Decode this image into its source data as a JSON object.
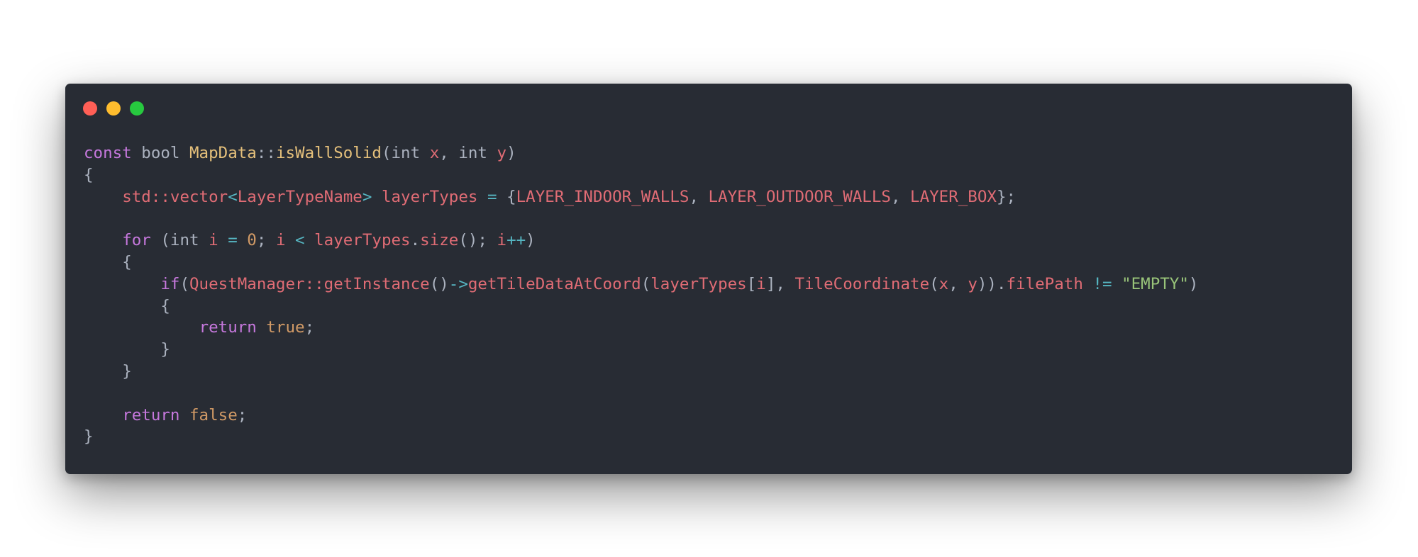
{
  "window": {
    "controls": [
      {
        "name": "close",
        "color": "#ff5f56"
      },
      {
        "name": "minimize",
        "color": "#ffbd2e"
      },
      {
        "name": "maximize",
        "color": "#27c93f"
      }
    ],
    "background": "#282c34"
  },
  "theme": {
    "keyword": "#c678dd",
    "class": "#e5c07b",
    "function": "#e06c75",
    "identifier": "#e06c75",
    "operator": "#56b6c2",
    "number": "#d19a66",
    "string": "#98c379",
    "punctuation": "#abb2bf"
  },
  "code": {
    "lines": [
      [
        {
          "t": "const",
          "c": "keyword"
        },
        {
          "t": " ",
          "c": "plain"
        },
        {
          "t": "bool",
          "c": "type"
        },
        {
          "t": " ",
          "c": "plain"
        },
        {
          "t": "MapData",
          "c": "class"
        },
        {
          "t": "::",
          "c": "punct"
        },
        {
          "t": "isWallSolid",
          "c": "class"
        },
        {
          "t": "(",
          "c": "punct"
        },
        {
          "t": "int",
          "c": "type"
        },
        {
          "t": " ",
          "c": "plain"
        },
        {
          "t": "x",
          "c": "param"
        },
        {
          "t": ", ",
          "c": "punct"
        },
        {
          "t": "int",
          "c": "type"
        },
        {
          "t": " ",
          "c": "plain"
        },
        {
          "t": "y",
          "c": "param"
        },
        {
          "t": ")",
          "c": "punct"
        }
      ],
      [
        {
          "t": "{",
          "c": "punct"
        }
      ],
      [
        {
          "t": "    ",
          "c": "plain"
        },
        {
          "t": "std",
          "c": "ident"
        },
        {
          "t": "::",
          "c": "ident"
        },
        {
          "t": "vector",
          "c": "ident"
        },
        {
          "t": "<",
          "c": "op"
        },
        {
          "t": "LayerTypeName",
          "c": "ident"
        },
        {
          "t": ">",
          "c": "op"
        },
        {
          "t": " ",
          "c": "plain"
        },
        {
          "t": "layerTypes",
          "c": "ident"
        },
        {
          "t": " ",
          "c": "plain"
        },
        {
          "t": "=",
          "c": "op"
        },
        {
          "t": " ",
          "c": "plain"
        },
        {
          "t": "{",
          "c": "punct"
        },
        {
          "t": "LAYER_INDOOR_WALLS",
          "c": "ident"
        },
        {
          "t": ", ",
          "c": "punct"
        },
        {
          "t": "LAYER_OUTDOOR_WALLS",
          "c": "ident"
        },
        {
          "t": ", ",
          "c": "punct"
        },
        {
          "t": "LAYER_BOX",
          "c": "ident"
        },
        {
          "t": "};",
          "c": "punct"
        }
      ],
      [],
      [
        {
          "t": "    ",
          "c": "plain"
        },
        {
          "t": "for",
          "c": "keyword"
        },
        {
          "t": " ",
          "c": "plain"
        },
        {
          "t": "(",
          "c": "punct"
        },
        {
          "t": "int",
          "c": "type"
        },
        {
          "t": " ",
          "c": "plain"
        },
        {
          "t": "i",
          "c": "ident"
        },
        {
          "t": " ",
          "c": "plain"
        },
        {
          "t": "=",
          "c": "op"
        },
        {
          "t": " ",
          "c": "plain"
        },
        {
          "t": "0",
          "c": "number"
        },
        {
          "t": "; ",
          "c": "punct"
        },
        {
          "t": "i",
          "c": "ident"
        },
        {
          "t": " ",
          "c": "plain"
        },
        {
          "t": "<",
          "c": "op"
        },
        {
          "t": " ",
          "c": "plain"
        },
        {
          "t": "layerTypes",
          "c": "ident"
        },
        {
          "t": ".",
          "c": "punct"
        },
        {
          "t": "size",
          "c": "func"
        },
        {
          "t": "(); ",
          "c": "punct"
        },
        {
          "t": "i",
          "c": "ident"
        },
        {
          "t": "++",
          "c": "op"
        },
        {
          "t": ")",
          "c": "punct"
        }
      ],
      [
        {
          "t": "    ",
          "c": "plain"
        },
        {
          "t": "{",
          "c": "punct"
        }
      ],
      [
        {
          "t": "        ",
          "c": "plain"
        },
        {
          "t": "if",
          "c": "keyword"
        },
        {
          "t": "(",
          "c": "punct"
        },
        {
          "t": "QuestManager",
          "c": "ident"
        },
        {
          "t": "::",
          "c": "ident"
        },
        {
          "t": "getInstance",
          "c": "func"
        },
        {
          "t": "()",
          "c": "punct"
        },
        {
          "t": "->",
          "c": "op"
        },
        {
          "t": "getTileDataAtCoord",
          "c": "func"
        },
        {
          "t": "(",
          "c": "punct"
        },
        {
          "t": "layerTypes",
          "c": "ident"
        },
        {
          "t": "[",
          "c": "punct"
        },
        {
          "t": "i",
          "c": "ident"
        },
        {
          "t": "], ",
          "c": "punct"
        },
        {
          "t": "TileCoordinate",
          "c": "func"
        },
        {
          "t": "(",
          "c": "punct"
        },
        {
          "t": "x",
          "c": "ident"
        },
        {
          "t": ", ",
          "c": "punct"
        },
        {
          "t": "y",
          "c": "ident"
        },
        {
          "t": ")).",
          "c": "punct"
        },
        {
          "t": "filePath",
          "c": "ident"
        },
        {
          "t": " ",
          "c": "plain"
        },
        {
          "t": "!=",
          "c": "op"
        },
        {
          "t": " ",
          "c": "plain"
        },
        {
          "t": "\"EMPTY\"",
          "c": "string"
        },
        {
          "t": ")",
          "c": "punct"
        }
      ],
      [
        {
          "t": "        ",
          "c": "plain"
        },
        {
          "t": "{",
          "c": "punct"
        }
      ],
      [
        {
          "t": "            ",
          "c": "plain"
        },
        {
          "t": "return",
          "c": "keyword"
        },
        {
          "t": " ",
          "c": "plain"
        },
        {
          "t": "true",
          "c": "bool"
        },
        {
          "t": ";",
          "c": "punct"
        }
      ],
      [
        {
          "t": "        ",
          "c": "plain"
        },
        {
          "t": "}",
          "c": "punct"
        }
      ],
      [
        {
          "t": "    ",
          "c": "plain"
        },
        {
          "t": "}",
          "c": "punct"
        }
      ],
      [],
      [
        {
          "t": "    ",
          "c": "plain"
        },
        {
          "t": "return",
          "c": "keyword"
        },
        {
          "t": " ",
          "c": "plain"
        },
        {
          "t": "false",
          "c": "bool"
        },
        {
          "t": ";",
          "c": "punct"
        }
      ],
      [
        {
          "t": "}",
          "c": "punct"
        }
      ]
    ]
  }
}
